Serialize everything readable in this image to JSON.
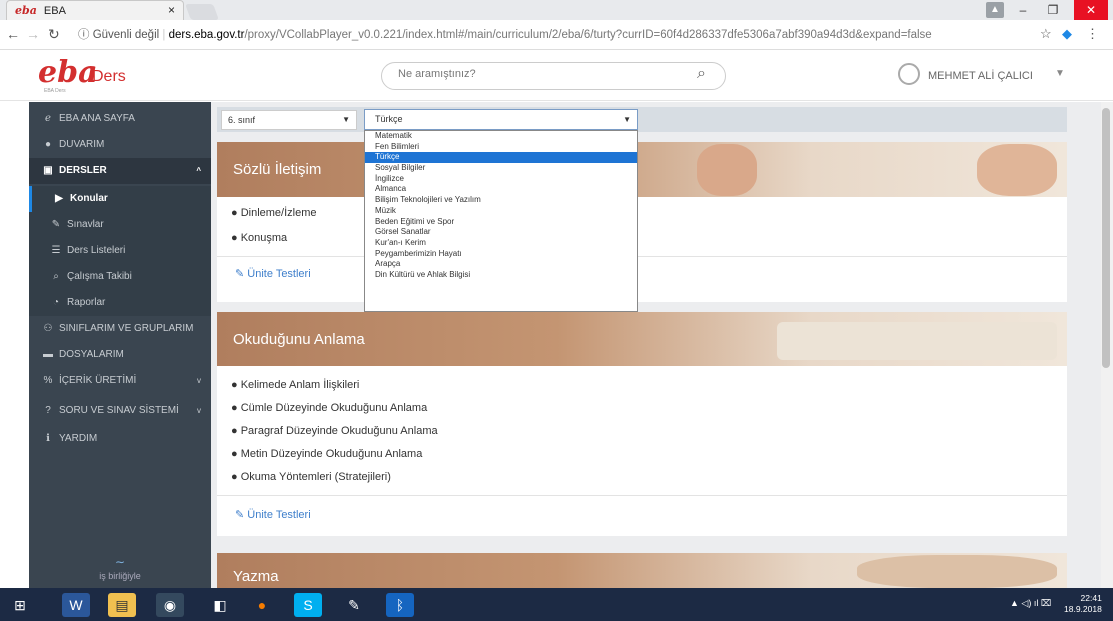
{
  "browser": {
    "tab_title": "EBA",
    "tab_logo": "eba",
    "tab_close": "×",
    "security": "ⓘ Güvenli değil",
    "url_domain": "ders.eba.gov.tr",
    "url_path": "/proxy/VCollabPlayer_v0.0.221/index.html#/main/curriculum/2/eba/6/turty?currID=60f4d286337dfe5306a7abf390a94d3d&expand=false"
  },
  "header": {
    "logo": "eba",
    "logo_suffix": "Ders",
    "logo_sub": "EBA Ders",
    "search_placeholder": "Ne aramıştınız?",
    "user_name": "MEHMET ALİ ÇALICI"
  },
  "sidebar": {
    "items": [
      {
        "label": "EBA ANA SAYFA",
        "icon": "eba-icon"
      },
      {
        "label": "DUVARIM",
        "icon": "user-icon"
      },
      {
        "label": "DERSLER",
        "icon": "lesson-icon"
      },
      {
        "label": "Konular",
        "icon": "play-icon"
      },
      {
        "label": "Sınavlar",
        "icon": "pencil-icon"
      },
      {
        "label": "Ders Listeleri",
        "icon": "list-icon"
      },
      {
        "label": "Çalışma Takibi",
        "icon": "tracking-icon"
      },
      {
        "label": "Raporlar",
        "icon": "chart-icon"
      },
      {
        "label": "SINIFLARIM VE GRUPLARIM",
        "icon": "group-icon"
      },
      {
        "label": "DOSYALARIM",
        "icon": "folder-icon"
      },
      {
        "label": "İÇERİK ÜRETİMİ",
        "icon": "content-icon"
      },
      {
        "label": "SORU VE SINAV SİSTEMİ",
        "icon": "question-icon"
      },
      {
        "label": "YARDIM",
        "icon": "info-icon"
      }
    ],
    "partner": "iş birliğiyle"
  },
  "filters": {
    "grade": "6. sınıf",
    "subject": "Türkçe",
    "subject_options": [
      "Matematik",
      "Fen Bilimleri",
      "Türkçe",
      "Sosyal Bilgiler",
      "İngilizce",
      "Almanca",
      "Bilişim Teknolojileri ve Yazılım",
      "Müzik",
      "Beden Eğitimi ve Spor",
      "Görsel Sanatlar",
      "Kur'an-ı Kerim",
      "Peygamberimizin Hayatı",
      "Arapça",
      "Din Kültürü ve Ahlak Bilgisi"
    ]
  },
  "cards": [
    {
      "title": "Sözlü İletişim",
      "items": [
        "Dinleme/İzleme",
        "Konuşma"
      ],
      "link": "Ünite Testleri"
    },
    {
      "title": "Okuduğunu Anlama",
      "items": [
        "Kelimede Anlam İlişkileri",
        "Cümle Düzeyinde Okuduğunu Anlama",
        "Paragraf Düzeyinde Okuduğunu Anlama",
        "Metin Düzeyinde Okuduğunu Anlama",
        "Okuma Yöntemleri (Stratejileri)"
      ],
      "link": "Ünite Testleri"
    },
    {
      "title": "Yazma"
    }
  ],
  "taskbar": {
    "time": "22:41",
    "date": "18.9.2018"
  }
}
